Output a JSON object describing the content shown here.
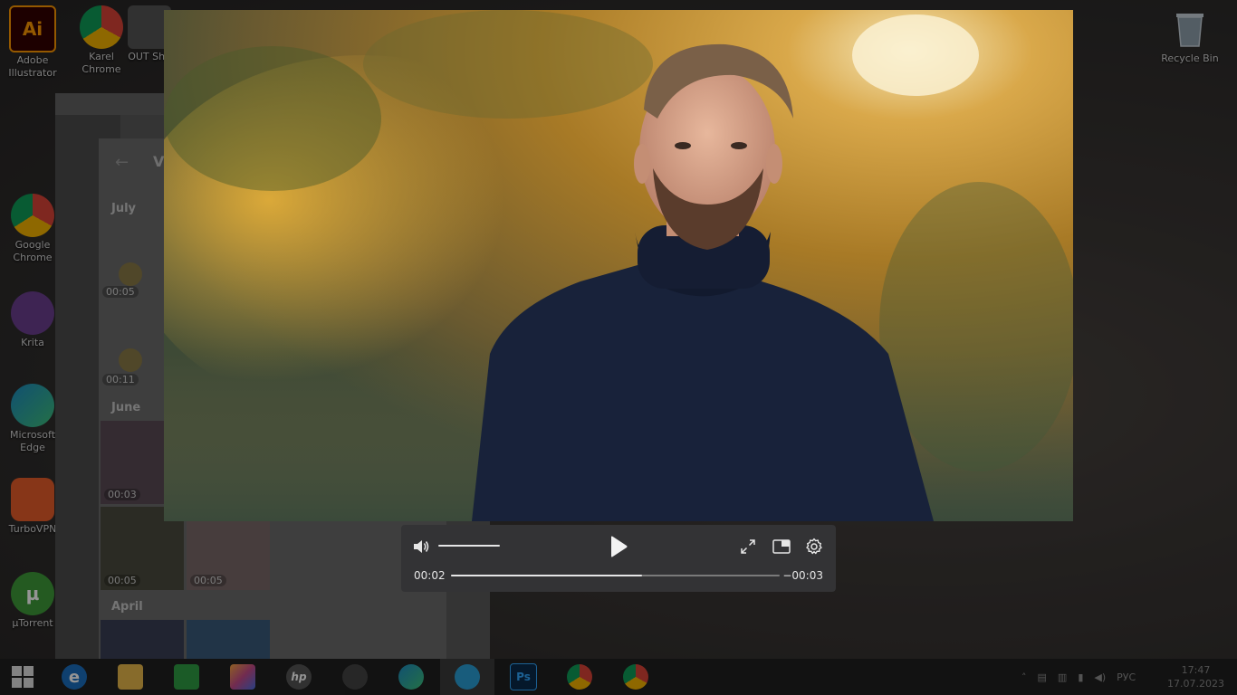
{
  "desktop": {
    "icons": [
      {
        "label": "Adobe Illustrator",
        "icon": "adobe-illustrator-icon",
        "glyph": "Ai",
        "color": "#ff9a00",
        "bg": "#330000"
      },
      {
        "label": "Karel Chrome",
        "icon": "chrome-icon",
        "glyph": "",
        "color": "#fff",
        "bg": "#3a7bd5"
      },
      {
        "label": "OUT Sho",
        "icon": "app-icon",
        "glyph": "",
        "color": "#fff",
        "bg": "#555"
      },
      {
        "label": "Google Chrome",
        "icon": "chrome-icon",
        "glyph": "",
        "color": "#fff",
        "bg": "#3a7bd5"
      },
      {
        "label": "Krita",
        "icon": "krita-icon",
        "glyph": "",
        "color": "#fff",
        "bg": "#6b3f8f"
      },
      {
        "label": "Microsoft Edge",
        "icon": "edge-icon",
        "glyph": "",
        "color": "#fff",
        "bg": "#1e8bc3"
      },
      {
        "label": "TurboVPN",
        "icon": "turbovpn-icon",
        "glyph": "",
        "color": "#fff",
        "bg": "#e85d2a"
      },
      {
        "label": "µTorrent",
        "icon": "utorrent-icon",
        "glyph": "µ",
        "color": "#fff",
        "bg": "#3e9c3a"
      },
      {
        "label": "Recycle Bin",
        "icon": "recycle-bin-icon",
        "glyph": "",
        "color": "#fff",
        "bg": "#7a8a99"
      }
    ]
  },
  "telegram": {
    "months": [
      "July",
      "June",
      "April"
    ],
    "round_durations": [
      "00:05",
      "00:11"
    ],
    "thumb_durations": [
      "00:03",
      "00:05",
      "00:05"
    ]
  },
  "player": {
    "current_time": "00:02",
    "remaining_time": "−00:03",
    "progress": 0.58,
    "volume": 1.0
  },
  "taskbar": {
    "apps": [
      {
        "name": "start-button",
        "glyph": "",
        "bg": ""
      },
      {
        "name": "internet-explorer",
        "glyph": "e",
        "bg": "#1a6fc0"
      },
      {
        "name": "file-explorer",
        "glyph": "",
        "bg": "#e8b84a"
      },
      {
        "name": "store",
        "glyph": "",
        "bg": "#2f9e44"
      },
      {
        "name": "photos",
        "glyph": "",
        "bg": "#c44b8a"
      },
      {
        "name": "hp",
        "glyph": "hp",
        "bg": "#555555"
      },
      {
        "name": "webcam",
        "glyph": "",
        "bg": "#444444"
      },
      {
        "name": "edge",
        "glyph": "",
        "bg": "#1e8bc3"
      },
      {
        "name": "telegram",
        "glyph": "",
        "bg": "#2a9fd6"
      },
      {
        "name": "photoshop",
        "glyph": "Ps",
        "bg": "#0a2a4a"
      },
      {
        "name": "chrome",
        "glyph": "",
        "bg": "#3a7bd5"
      },
      {
        "name": "chrome-profile",
        "glyph": "",
        "bg": "#3a7bd5"
      }
    ],
    "language": "РУС",
    "time": "17:47",
    "date": "17.07.2023"
  }
}
